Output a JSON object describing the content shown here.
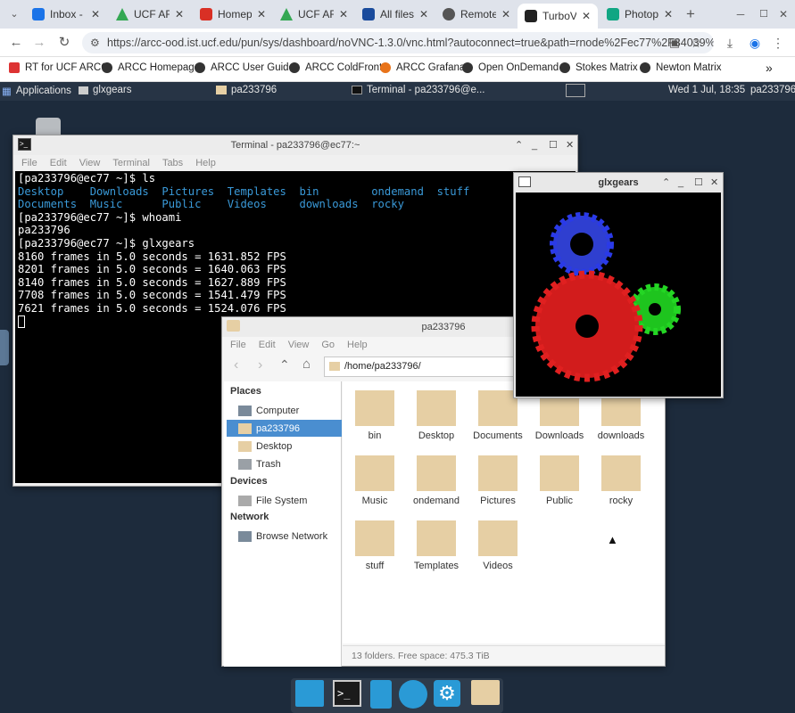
{
  "browser": {
    "tabs": [
      {
        "label": "Inbox - P",
        "fav_color": "#1a73e8",
        "active": false
      },
      {
        "label": "UCF ARC",
        "fav_color": "#34a853",
        "active": false
      },
      {
        "label": "Homepa",
        "fav_color": "#d93025",
        "active": false
      },
      {
        "label": "UCF ARC",
        "fav_color": "#34a853",
        "active": false
      },
      {
        "label": "All files",
        "fav_color": "#1a4b9c",
        "active": false
      },
      {
        "label": "Remote",
        "fav_color": "#555555",
        "active": false
      },
      {
        "label": "TurboVN",
        "fav_color": "#222222",
        "active": true
      },
      {
        "label": "Photope",
        "fav_color": "#11a683",
        "active": false
      }
    ],
    "new_tab": "+",
    "url": "https://arcc-ood.ist.ucf.edu/pun/sys/dashboard/noVNC-1.3.0/vnc.html?autoconnect=true&path=rnode%2Fec77%2F34039%2F...",
    "bookmarks": [
      {
        "label": "RT for UCF ARCC",
        "color": "#d33"
      },
      {
        "label": "ARCC Homepage",
        "color": "#333"
      },
      {
        "label": "ARCC User Guide",
        "color": "#333"
      },
      {
        "label": "ARCC ColdFront",
        "color": "#333"
      },
      {
        "label": "ARCC Grafana",
        "color": "#e8731a"
      },
      {
        "label": "Open OnDemand",
        "color": "#333"
      },
      {
        "label": "Stokes Matrix",
        "color": "#333"
      },
      {
        "label": "Newton Matrix",
        "color": "#333"
      }
    ],
    "more": "»"
  },
  "panel": {
    "applications": "Applications",
    "task1": "glxgears",
    "task2": "pa233796",
    "task3": "Terminal - pa233796@e...",
    "clock": "Wed  1 Jul, 18:35",
    "user": "pa233796"
  },
  "terminal": {
    "title": "Terminal - pa233796@ec77:~",
    "menu": [
      "File",
      "Edit",
      "View",
      "Terminal",
      "Tabs",
      "Help"
    ],
    "lines": [
      "[pa233796@ec77 ~]$ ls",
      "",
      "",
      "[pa233796@ec77 ~]$ whoami",
      "pa233796",
      "[pa233796@ec77 ~]$ glxgears",
      "8160 frames in 5.0 seconds = 1631.852 FPS",
      "8201 frames in 5.0 seconds = 1640.063 FPS",
      "8140 frames in 5.0 seconds = 1627.889 FPS",
      "7708 frames in 5.0 seconds = 1541.479 FPS",
      "7621 frames in 5.0 seconds = 1524.076 FPS"
    ],
    "ls_row1": "Desktop    Downloads  Pictures  Templates  bin        ondemand  stuff",
    "ls_row2": "Documents  Music      Public    Videos     downloads  rocky"
  },
  "glxgears": {
    "title": "glxgears"
  },
  "filemanager": {
    "title": "pa233796",
    "menu": [
      "File",
      "Edit",
      "View",
      "Go",
      "Help"
    ],
    "path": "/home/pa233796/",
    "places_header": "Places",
    "places": [
      "Computer",
      "pa233796",
      "Desktop",
      "Trash"
    ],
    "devices_header": "Devices",
    "devices": [
      "File System"
    ],
    "network_header": "Network",
    "network": [
      "Browse Network"
    ],
    "folders": [
      "bin",
      "Desktop",
      "Documents",
      "Downloads",
      "downloads",
      "Music",
      "ondemand",
      "Pictures",
      "Public",
      "rocky",
      "stuff",
      "Templates",
      "Videos"
    ],
    "status": "13 folders. Free space: 475.3 TiB"
  }
}
